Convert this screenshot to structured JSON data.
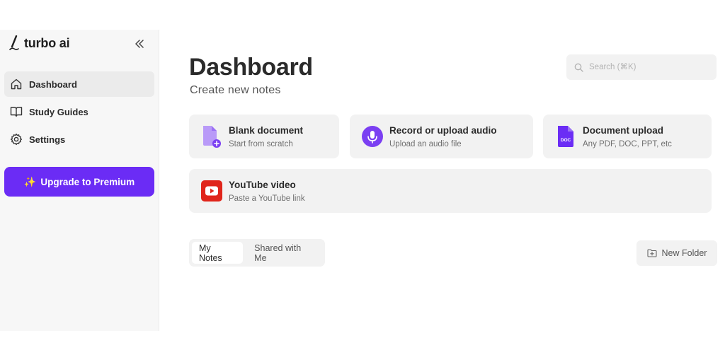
{
  "brand": {
    "name": "turbo ai",
    "accent": "#6b2cf5"
  },
  "sidebar": {
    "collapse_icon": "double-chevron-left-icon",
    "items": [
      {
        "label": "Dashboard",
        "icon": "home-icon",
        "active": true
      },
      {
        "label": "Study Guides",
        "icon": "book-icon",
        "active": false
      },
      {
        "label": "Settings",
        "icon": "gear-icon",
        "active": false
      }
    ],
    "upgrade_label": "Upgrade to Premium",
    "upgrade_icon": "sparkles-icon"
  },
  "main": {
    "title": "Dashboard",
    "subtitle": "Create new notes",
    "search": {
      "placeholder": "Search (⌘K)",
      "icon": "search-icon"
    },
    "cards": [
      {
        "title": "Blank document",
        "subtitle": "Start from scratch",
        "icon": "new-document-icon"
      },
      {
        "title": "Record or upload audio",
        "subtitle": "Upload an audio file",
        "icon": "microphone-icon"
      },
      {
        "title": "Document upload",
        "subtitle": "Any PDF, DOC, PPT, etc",
        "icon": "doc-file-icon",
        "icon_text": "DOC"
      },
      {
        "title": "YouTube video",
        "subtitle": "Paste a YouTube link",
        "icon": "youtube-icon"
      }
    ],
    "tabs": [
      {
        "label": "My Notes",
        "active": true
      },
      {
        "label": "Shared with Me",
        "active": false
      }
    ],
    "new_folder_label": "New Folder",
    "new_folder_icon": "folder-plus-icon"
  }
}
